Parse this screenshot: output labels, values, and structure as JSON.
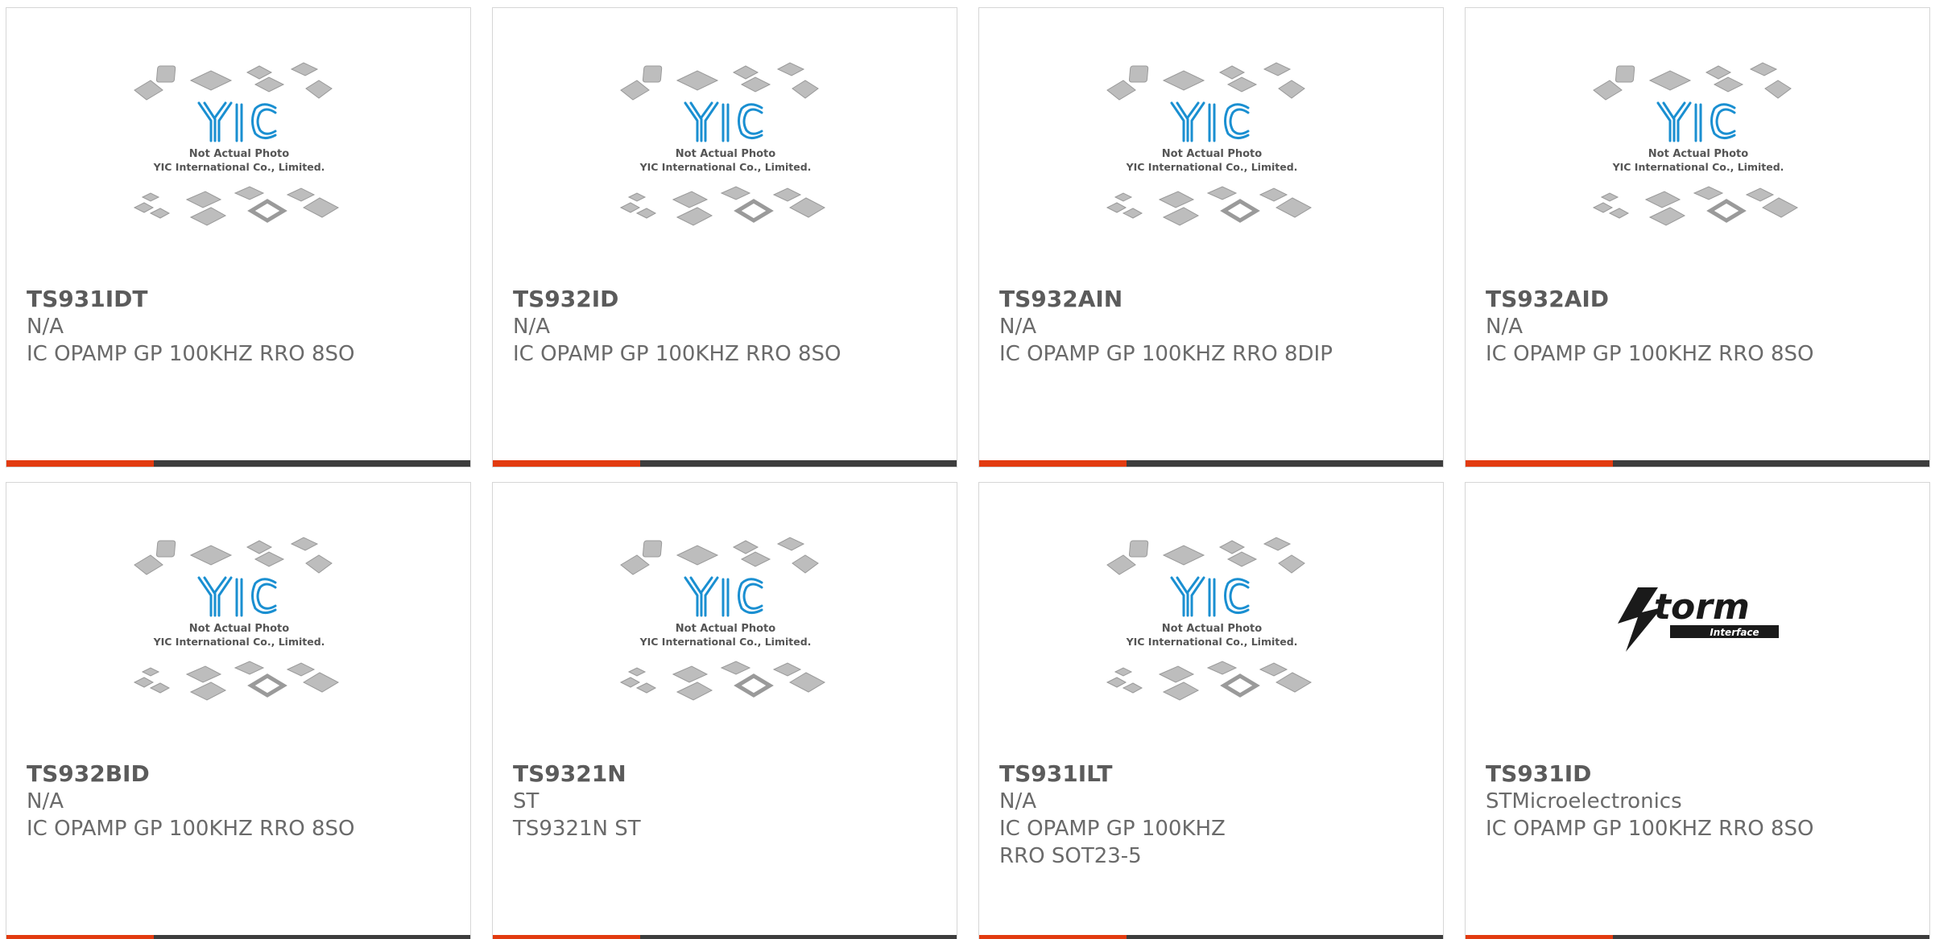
{
  "colors": {
    "accent": "#e23b10",
    "bar_dark": "#3d3d3d",
    "logo_blue": "#1a8fd1",
    "chip_gray": "#bdbdbd"
  },
  "placeholder": {
    "line1": "Not Actual Photo",
    "line2": "YIC International Co., Limited.",
    "logo_text": "YIC"
  },
  "storm_logo": {
    "brand": "Storm",
    "sub": "Interface"
  },
  "products": [
    {
      "part": "TS931IDT",
      "manufacturer": "N/A",
      "description": "IC OPAMP GP 100KHZ RRO 8SO",
      "image": "placeholder"
    },
    {
      "part": "TS932ID",
      "manufacturer": "N/A",
      "description": "IC OPAMP GP 100KHZ RRO 8SO",
      "image": "placeholder"
    },
    {
      "part": "TS932AIN",
      "manufacturer": "N/A",
      "description": "IC OPAMP GP 100KHZ RRO 8DIP",
      "image": "placeholder"
    },
    {
      "part": "TS932AID",
      "manufacturer": "N/A",
      "description": "IC OPAMP GP 100KHZ RRO 8SO",
      "image": "placeholder"
    },
    {
      "part": "TS932BID",
      "manufacturer": "N/A",
      "description": "IC OPAMP GP 100KHZ RRO 8SO",
      "image": "placeholder"
    },
    {
      "part": "TS9321N",
      "manufacturer": "ST",
      "description": "TS9321N ST",
      "image": "placeholder"
    },
    {
      "part": "TS931ILT",
      "manufacturer": "N/A",
      "description": "IC OPAMP GP 100KHZ RRO SOT23-5",
      "image": "placeholder"
    },
    {
      "part": "TS931ID",
      "manufacturer": "STMicroelectronics",
      "description": "IC OPAMP GP 100KHZ RRO 8SO",
      "image": "storm-logo"
    }
  ]
}
